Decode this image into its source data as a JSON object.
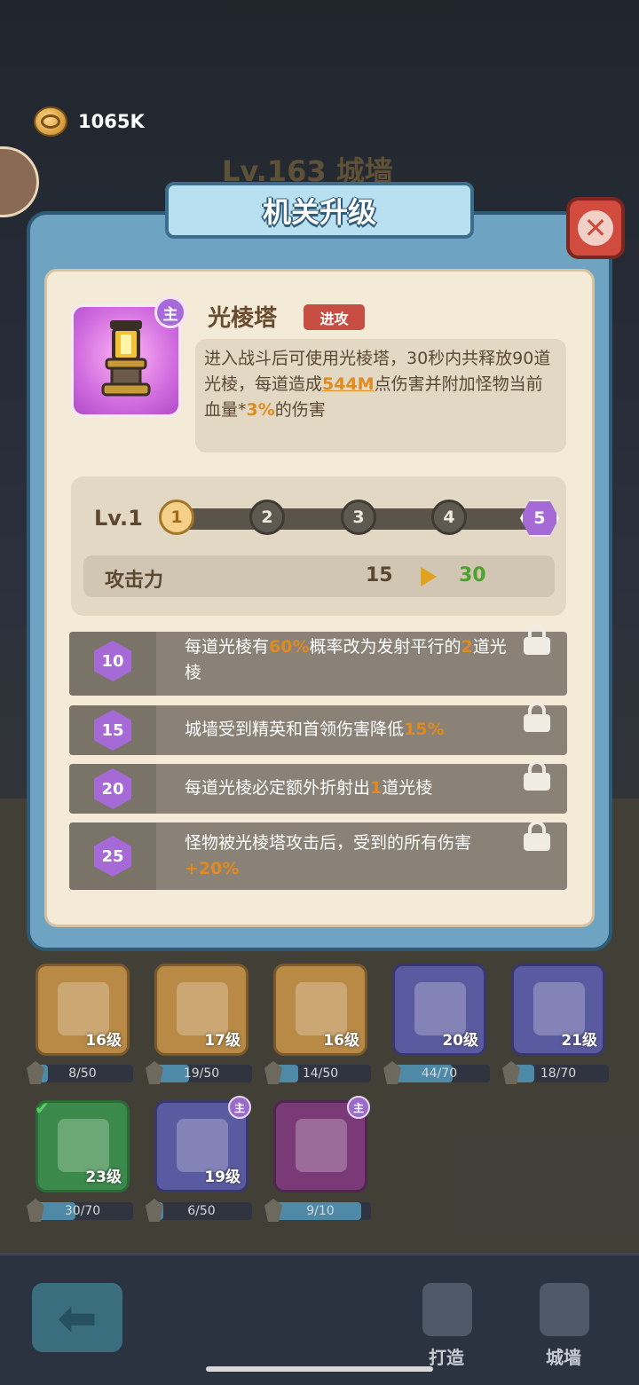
{
  "currency": {
    "icon": "gold-coin-icon",
    "value": "1065K"
  },
  "background_title": "Lv.163 城墙",
  "dialog": {
    "title": "机关升级",
    "close_icon": "close-x-icon"
  },
  "item": {
    "name": "光棱塔",
    "tag": "进攻",
    "main_badge": "主",
    "desc_part1": "进入战斗后可使用光棱塔，30秒内共释放90道光棱，每道造成",
    "desc_highlight1": "544M",
    "desc_part2": "点伤害并附加怪物当前血量*",
    "desc_highlight2": "3%",
    "desc_part3": "的伤害"
  },
  "level_track": {
    "label": "Lv.1",
    "nodes": [
      "1",
      "2",
      "3",
      "4",
      "5"
    ],
    "current": 1
  },
  "stat": {
    "name": "攻击力",
    "from": "15",
    "to": "30"
  },
  "unlocks": [
    {
      "level": "10",
      "t1": "每道光棱有",
      "h1": "60%",
      "t2": "概率改为发射平行的",
      "h2": "2",
      "t3": "道光棱",
      "locked": true
    },
    {
      "level": "15",
      "t1": "城墙受到精英和首领伤害降低",
      "h1": "15%",
      "t2": "",
      "h2": "",
      "t3": "",
      "locked": true
    },
    {
      "level": "20",
      "t1": "每道光棱必定额外折射出",
      "h1": "1",
      "t2": "道光棱",
      "h2": "",
      "t3": "",
      "locked": true
    },
    {
      "level": "25",
      "t1": "怪物被光棱塔攻击后，受到的所有伤害",
      "h1": "+20%",
      "t2": "",
      "h2": "",
      "t3": "",
      "locked": true
    }
  ],
  "cards": [
    {
      "level": "16级",
      "progress": "8/50",
      "fraction": 0.16,
      "color": "orange"
    },
    {
      "level": "17级",
      "progress": "19/50",
      "fraction": 0.38,
      "color": "orange"
    },
    {
      "level": "16级",
      "progress": "14/50",
      "fraction": 0.28,
      "color": "orange"
    },
    {
      "level": "20级",
      "progress": "44/70",
      "fraction": 0.63,
      "color": "blue"
    },
    {
      "level": "21级",
      "progress": "18/70",
      "fraction": 0.26,
      "color": "blue"
    },
    {
      "level": "23级",
      "progress": "30/70",
      "fraction": 0.43,
      "color": "green"
    },
    {
      "level": "19级",
      "progress": "6/50",
      "fraction": 0.12,
      "color": "blue",
      "mark": "主"
    },
    {
      "level": "",
      "progress": "9/10",
      "fraction": 0.9,
      "color": "purple",
      "mark": "主"
    }
  ],
  "bottom_nav": {
    "back_icon": "back-arrow-icon",
    "items": [
      {
        "label": "打造",
        "icon": "gear-icon"
      },
      {
        "label": "城墙",
        "icon": "castle-icon"
      }
    ]
  }
}
